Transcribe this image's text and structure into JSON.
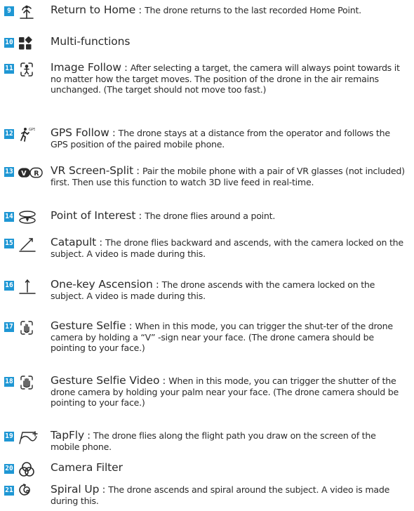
{
  "colors": {
    "badge": "#1f97d4",
    "text": "#2b2b2b"
  },
  "items": [
    {
      "num": "9",
      "icon": "return-home-icon",
      "title": "Return to Home",
      "sep": " : ",
      "desc": "The drone returns to the last recorded Home Point."
    },
    {
      "num": "10",
      "icon": "multi-functions-icon",
      "title": "Multi-functions",
      "sep": "",
      "desc": ""
    },
    {
      "num": "11",
      "icon": "image-follow-icon",
      "title": "Image Follow",
      "sep": " : ",
      "desc": "After selecting a target, the camera will always point towards it no matter how the target moves. The position of the drone in the air remains unchanged. (The target should not move too fast.)"
    },
    {
      "num": "12",
      "icon": "gps-follow-icon",
      "title": "GPS Follow",
      "sep": " : ",
      "desc": "The drone stays at a distance from the operator and follows the GPS position of the paired mobile phone."
    },
    {
      "num": "13",
      "icon": "vr-split-icon",
      "title": "VR Screen-Split",
      "sep": " : ",
      "desc": "Pair the mobile phone with a pair of VR glasses (not included) first. Then use this function to watch 3D live feed in real-time."
    },
    {
      "num": "14",
      "icon": "point-of-interest-icon",
      "title": "Point of Interest",
      "sep": " : ",
      "desc": "The drone flies around a point."
    },
    {
      "num": "15",
      "icon": "catapult-icon",
      "title": "Catapult",
      "sep": " : ",
      "desc": "The drone flies backward and ascends, with the camera locked on the subject. A video is made during this."
    },
    {
      "num": "16",
      "icon": "one-key-ascension-icon",
      "title": "One-key Ascension",
      "sep": " : ",
      "desc": "The drone ascends with the camera locked on the subject. A video is made during this."
    },
    {
      "num": "17",
      "icon": "gesture-selfie-icon",
      "title": "Gesture Selfie",
      "sep": " :  ",
      "desc": "When in this mode, you can trigger the shut-ter of the drone camera by holding a “V” -sign near your face. (The drone camera should be pointing to your face.)"
    },
    {
      "num": "18",
      "icon": "gesture-selfie-video-icon",
      "title": "Gesture Selfie Video",
      "sep": " : ",
      "desc": "When in this mode, you can trigger the shutter of the drone camera by holding your palm near your face. (The drone camera should be pointing to your face.)"
    },
    {
      "num": "19",
      "icon": "tapfly-icon",
      "title": "TapFly",
      "sep": " : ",
      "desc": "The drone flies along the flight path you draw on the screen of the mobile phone."
    },
    {
      "num": "20",
      "icon": "camera-filter-icon",
      "title": "Camera Filter",
      "sep": "",
      "desc": ""
    },
    {
      "num": "21",
      "icon": "spiral-up-icon",
      "title": "Spiral Up",
      "sep": " : ",
      "desc": "The drone ascends and spiral around the subject. A video is made during this."
    }
  ]
}
